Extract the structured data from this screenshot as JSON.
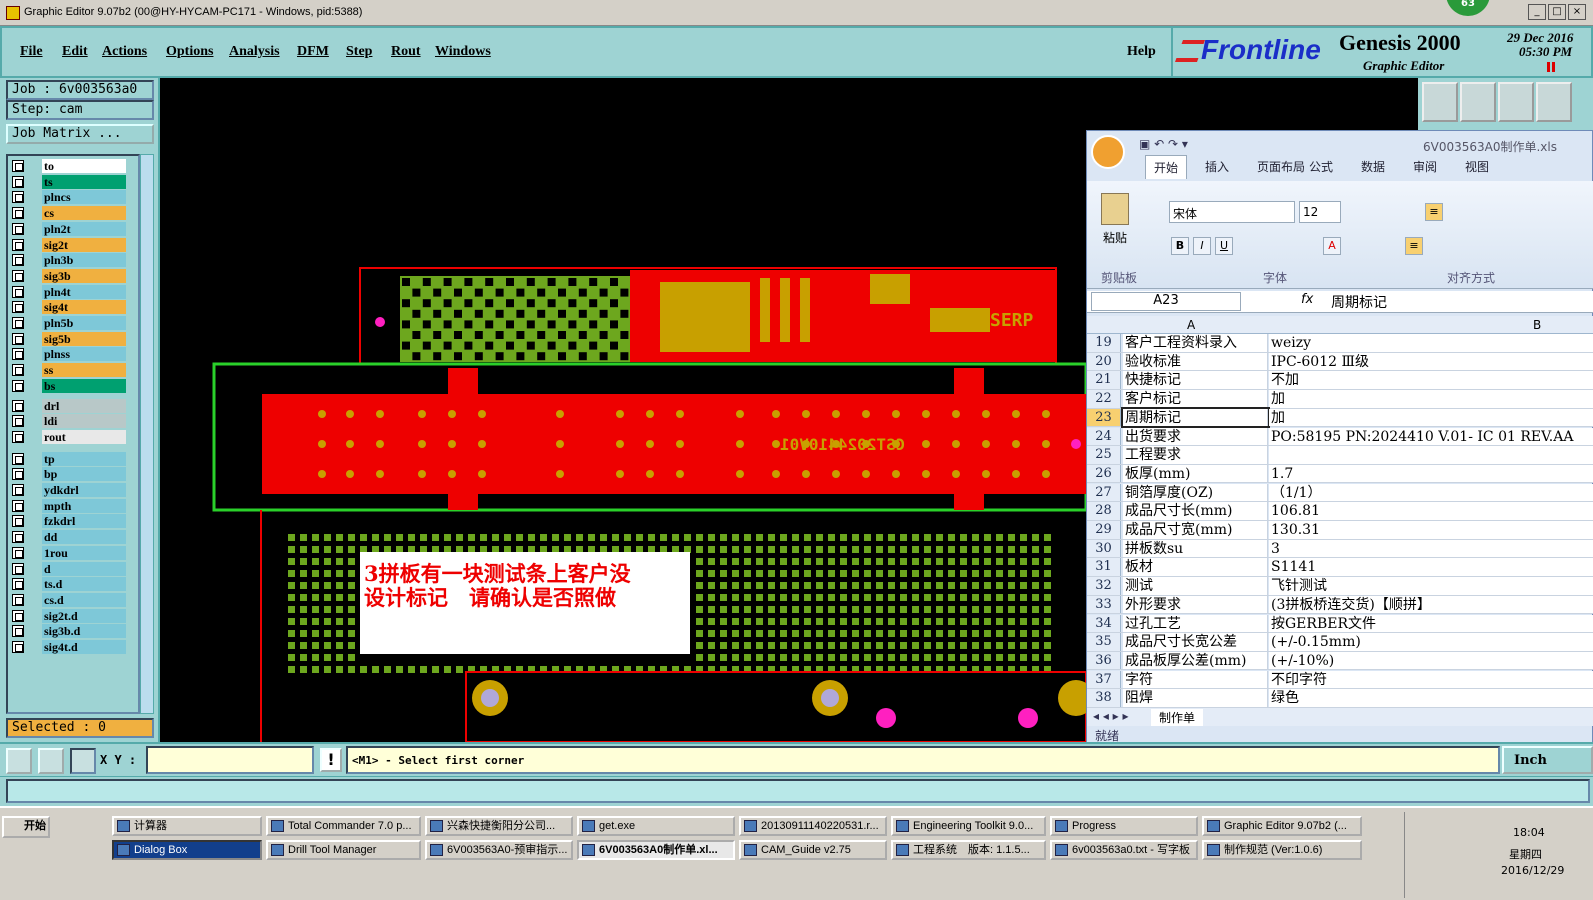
{
  "window": {
    "title": "Graphic Editor 9.07b2 (00@HY-HYCAM-PC171 - Windows, pid:5388)",
    "notification_count": "63"
  },
  "menu": [
    "File",
    "Edit",
    "Actions",
    "Options",
    "Analysis",
    "DFM",
    "Step",
    "Rout",
    "Windows"
  ],
  "help_label": "Help",
  "brand": {
    "logo": "Frontline",
    "product": "Genesis 2000",
    "subtitle": "Graphic Editor",
    "date": "29 Dec 2016",
    "time": "05:30 PM"
  },
  "job": {
    "job_label": "Job : 6v003563a0",
    "step_label": "Step: cam",
    "matrix_button": "Job Matrix ..."
  },
  "layers": [
    {
      "name": "to",
      "color": "#ffffff"
    },
    {
      "name": "ts",
      "color": "#00a070"
    },
    {
      "name": "plncs",
      "color": "#7ec8d8"
    },
    {
      "name": "cs",
      "color": "#f0b040"
    },
    {
      "name": "pln2t",
      "color": "#7ec8d8"
    },
    {
      "name": "sig2t",
      "color": "#f0b040"
    },
    {
      "name": "pln3b",
      "color": "#7ec8d8"
    },
    {
      "name": "sig3b",
      "color": "#f0b040"
    },
    {
      "name": "pln4t",
      "color": "#7ec8d8"
    },
    {
      "name": "sig4t",
      "color": "#f0b040"
    },
    {
      "name": "pln5b",
      "color": "#7ec8d8"
    },
    {
      "name": "sig5b",
      "color": "#f0b040"
    },
    {
      "name": "plnss",
      "color": "#7ec8d8"
    },
    {
      "name": "ss",
      "color": "#f0b040"
    },
    {
      "name": "bs",
      "color": "#00a070"
    },
    {
      "name": "drl",
      "color": "#b8c8c8"
    },
    {
      "name": "ldi",
      "color": "#b8c8c8"
    },
    {
      "name": "rout",
      "color": "#e8e8e8"
    },
    {
      "name": "tp",
      "color": "#7ec8d8"
    },
    {
      "name": "bp",
      "color": "#7ec8d8"
    },
    {
      "name": "ydkdrl",
      "color": "#7ec8d8"
    },
    {
      "name": "mpth",
      "color": "#7ec8d8"
    },
    {
      "name": "fzkdrl",
      "color": "#7ec8d8"
    },
    {
      "name": "dd",
      "color": "#7ec8d8"
    },
    {
      "name": "1rou",
      "color": "#7ec8d8"
    },
    {
      "name": "d",
      "color": "#7ec8d8"
    },
    {
      "name": "ts.d",
      "color": "#7ec8d8"
    },
    {
      "name": "cs.d",
      "color": "#7ec8d8"
    },
    {
      "name": "sig2t.d",
      "color": "#7ec8d8"
    },
    {
      "name": "sig3b.d",
      "color": "#7ec8d8"
    },
    {
      "name": "sig4t.d",
      "color": "#7ec8d8"
    }
  ],
  "selected_label": "Selected : 0",
  "xy_label": "X Y :",
  "status_message": "<M1> - Select first corner",
  "units": "Inch",
  "annotation": {
    "line1": "3拼板有一块测试条上客户没",
    "line2": "设计标记　请确认是否照做"
  },
  "pcb_text": {
    "serp": "SERP",
    "code": "CST2024410V01"
  },
  "excel": {
    "filename": "6V003563A0制作单.xls",
    "tabs": [
      "开始",
      "插入",
      "页面布局",
      "公式",
      "数据",
      "审阅",
      "视图"
    ],
    "font_name": "宋体",
    "font_size": "12",
    "group_labels": [
      "剪贴板",
      "字体",
      "对齐方式"
    ],
    "paste_label": "粘贴",
    "cell_ref": "A23",
    "formula": "周期标记",
    "col_a": "A",
    "col_b": "B",
    "rows": [
      {
        "n": "19",
        "a": "客户工程资料录入",
        "b": "weizy"
      },
      {
        "n": "20",
        "a": "验收标准",
        "b": "IPC-6012 Ⅲ级"
      },
      {
        "n": "21",
        "a": "快捷标记",
        "b": "不加"
      },
      {
        "n": "22",
        "a": "客户标记",
        "b": "加"
      },
      {
        "n": "23",
        "a": "周期标记",
        "b": "加"
      },
      {
        "n": "24",
        "a": "出货要求",
        "b": "PO:58195 PN:2024410 V.01- IC 01 REV.AA"
      },
      {
        "n": "25",
        "a": "工程要求",
        "b": ""
      },
      {
        "n": "26",
        "a": "板厚(mm)",
        "b": "1.7"
      },
      {
        "n": "27",
        "a": "铜箔厚度(OZ)",
        "b": "（1/1）"
      },
      {
        "n": "28",
        "a": "成品尺寸长(mm)",
        "b": "106.81"
      },
      {
        "n": "29",
        "a": "成品尺寸宽(mm)",
        "b": "130.31"
      },
      {
        "n": "30",
        "a": "拼板数su",
        "b": "3"
      },
      {
        "n": "31",
        "a": "板材",
        "b": "S1141"
      },
      {
        "n": "32",
        "a": "测试",
        "b": "飞针测试"
      },
      {
        "n": "33",
        "a": "外形要求",
        "b": "(3拼板桥连交货)【顺拼】"
      },
      {
        "n": "34",
        "a": "过孔工艺",
        "b": "按GERBER文件"
      },
      {
        "n": "35",
        "a": "成品尺寸长宽公差",
        "b": "(+/-0.15mm)"
      },
      {
        "n": "36",
        "a": "成品板厚公差(mm)",
        "b": "(+/-10%)"
      },
      {
        "n": "37",
        "a": "字符",
        "b": "不印字符"
      },
      {
        "n": "38",
        "a": "阻焊",
        "b": "绿色"
      }
    ],
    "sheet_tab": "制作单",
    "status": "就绪"
  },
  "taskbar": {
    "start": "开始",
    "row1": [
      "计算器",
      "Total Commander 7.0 p...",
      "兴森快捷衡阳分公司...",
      "get.exe",
      "20130911140220531.r...",
      "Engineering Toolkit 9.0...",
      "Progress",
      "Graphic Editor 9.07b2 (..."
    ],
    "row2": [
      "Dialog Box",
      "Drill Tool Manager",
      "6V003563A0-预审指示...",
      "6V003563A0制作单.xl...",
      "CAM_Guide v2.75",
      "工程系统　版本: 1.1.5...",
      "6v003563a0.txt - 写字板",
      "制作规范 (Ver:1.0.6)"
    ],
    "clock": "18:04",
    "weekday": "星期四",
    "date": "2016/12/29"
  }
}
